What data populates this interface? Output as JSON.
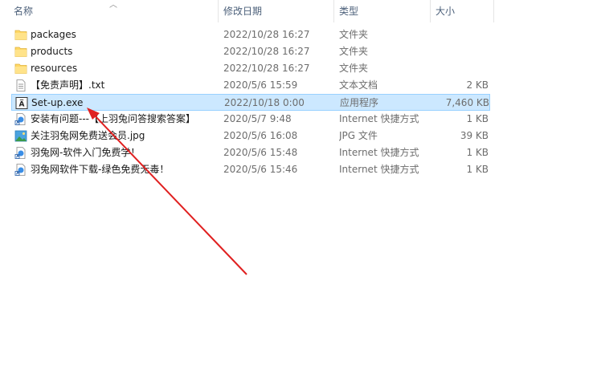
{
  "columns": {
    "name": "名称",
    "modified": "修改日期",
    "type": "类型",
    "size": "大小"
  },
  "files": [
    {
      "name": "packages",
      "modified": "2022/10/28 16:27",
      "type": "文件夹",
      "size": "",
      "icon": "folder-icon"
    },
    {
      "name": "products",
      "modified": "2022/10/28 16:27",
      "type": "文件夹",
      "size": "",
      "icon": "folder-icon"
    },
    {
      "name": "resources",
      "modified": "2022/10/28 16:27",
      "type": "文件夹",
      "size": "",
      "icon": "folder-icon"
    },
    {
      "name": "【免责声明】.txt",
      "modified": "2020/5/6 15:59",
      "type": "文本文档",
      "size": "2 KB",
      "icon": "text-file-icon"
    },
    {
      "name": "Set-up.exe",
      "modified": "2022/10/18 0:00",
      "type": "应用程序",
      "size": "7,460 KB",
      "icon": "adobe-app-icon",
      "selected": true
    },
    {
      "name": "安装有问题---【上羽兔问答搜索答案】",
      "modified": "2020/5/7 9:48",
      "type": "Internet 快捷方式",
      "size": "1 KB",
      "icon": "internet-shortcut-icon"
    },
    {
      "name": "关注羽兔网免费送会员.jpg",
      "modified": "2020/5/6 16:08",
      "type": "JPG 文件",
      "size": "39 KB",
      "icon": "image-file-icon"
    },
    {
      "name": "羽兔网-软件入门免费学！",
      "modified": "2020/5/6 15:48",
      "type": "Internet 快捷方式",
      "size": "1 KB",
      "icon": "internet-shortcut-icon"
    },
    {
      "name": "羽兔网软件下载-绿色免费无毒！",
      "modified": "2020/5/6 15:46",
      "type": "Internet 快捷方式",
      "size": "1 KB",
      "icon": "internet-shortcut-icon"
    }
  ],
  "colors": {
    "selection": "#cce8ff",
    "selection_border": "#99d1ff",
    "folder": "#ffd866",
    "annotation_arrow": "#e02020"
  }
}
